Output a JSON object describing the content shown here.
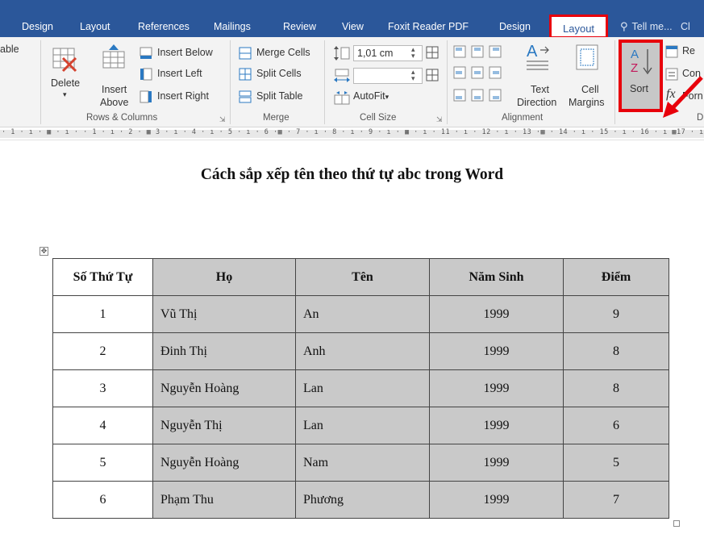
{
  "tabs": [
    {
      "label": "Design"
    },
    {
      "label": "Layout"
    },
    {
      "label": "References"
    },
    {
      "label": "Mailings"
    },
    {
      "label": "Review"
    },
    {
      "label": "View"
    },
    {
      "label": "Foxit Reader PDF"
    },
    {
      "label": "Design"
    },
    {
      "label": "Layout",
      "active": true
    }
  ],
  "tell_me": "Tell me...",
  "tab_overflow": "Cl",
  "ribbon": {
    "table_cut": "able",
    "rows_columns": {
      "delete": "Delete",
      "insert_above_line1": "Insert",
      "insert_above_line2": "Above",
      "insert_below": "Insert Below",
      "insert_left": "Insert Left",
      "insert_right": "Insert Right",
      "group_label": "Rows & Columns"
    },
    "merge": {
      "merge_cells": "Merge Cells",
      "split_cells": "Split Cells",
      "split_table": "Split Table",
      "group_label": "Merge"
    },
    "cell_size": {
      "height_value": "1,01 cm",
      "width_value": "",
      "autofit": "AutoFit",
      "group_label": "Cell Size"
    },
    "alignment": {
      "text_direction_line1": "Text",
      "text_direction_line2": "Direction",
      "cell_margins_line1": "Cell",
      "cell_margins_line2": "Margins",
      "group_label": "Alignment"
    },
    "data": {
      "sort": "Sort",
      "repeat_cut": "Re",
      "convert_cut": "Con",
      "formula_cut": "Forn",
      "group_label_cut": "D"
    }
  },
  "ruler_text": "· 1 · ı · ▦ · ı · · 1 · ı · 2 · ▦ 3 · ı · 4 · ı · 5 · ı · 6 ·▦ · 7 · ı · 8 · ı · 9 · ı · ▦ · ı · 11 · ı · 12 · ı · 13 ·▦ · 14 · ı · 15 · ı · 16 · ı ▦17 · ı",
  "document": {
    "title": "Cách sắp xếp tên theo thứ tự abc trong Word",
    "table": {
      "headers": [
        "Số Thứ Tự",
        "Họ",
        "Tên",
        "Năm Sinh",
        "Điểm"
      ],
      "rows": [
        [
          "1",
          "Vũ Thị",
          "An",
          "1999",
          "9"
        ],
        [
          "2",
          "Đinh Thị",
          "Anh",
          "1999",
          "8"
        ],
        [
          "3",
          "Nguyễn Hoàng",
          "Lan",
          "1999",
          "8"
        ],
        [
          "4",
          "Nguyễn Thị",
          "Lan",
          "1999",
          "6"
        ],
        [
          "5",
          "Nguyễn Hoàng",
          "Nam",
          "1999",
          "5"
        ],
        [
          "6",
          "Phạm Thu",
          "Phương",
          "1999",
          "7"
        ]
      ]
    }
  },
  "colors": {
    "ribbon_blue": "#2b579a",
    "highlight_red": "#e8000b",
    "cell_gray": "#c9c9c9"
  },
  "icons": [
    "table-move-icon",
    "delete-table-icon",
    "insert-above-icon",
    "insert-below-icon",
    "insert-left-icon",
    "insert-right-icon",
    "merge-cells-icon",
    "split-cells-icon",
    "split-table-icon",
    "autofit-icon",
    "align-icon",
    "text-direction-icon",
    "cell-margins-icon",
    "sort-az-icon",
    "formula-icon",
    "lightbulb-icon",
    "red-arrow-icon"
  ]
}
